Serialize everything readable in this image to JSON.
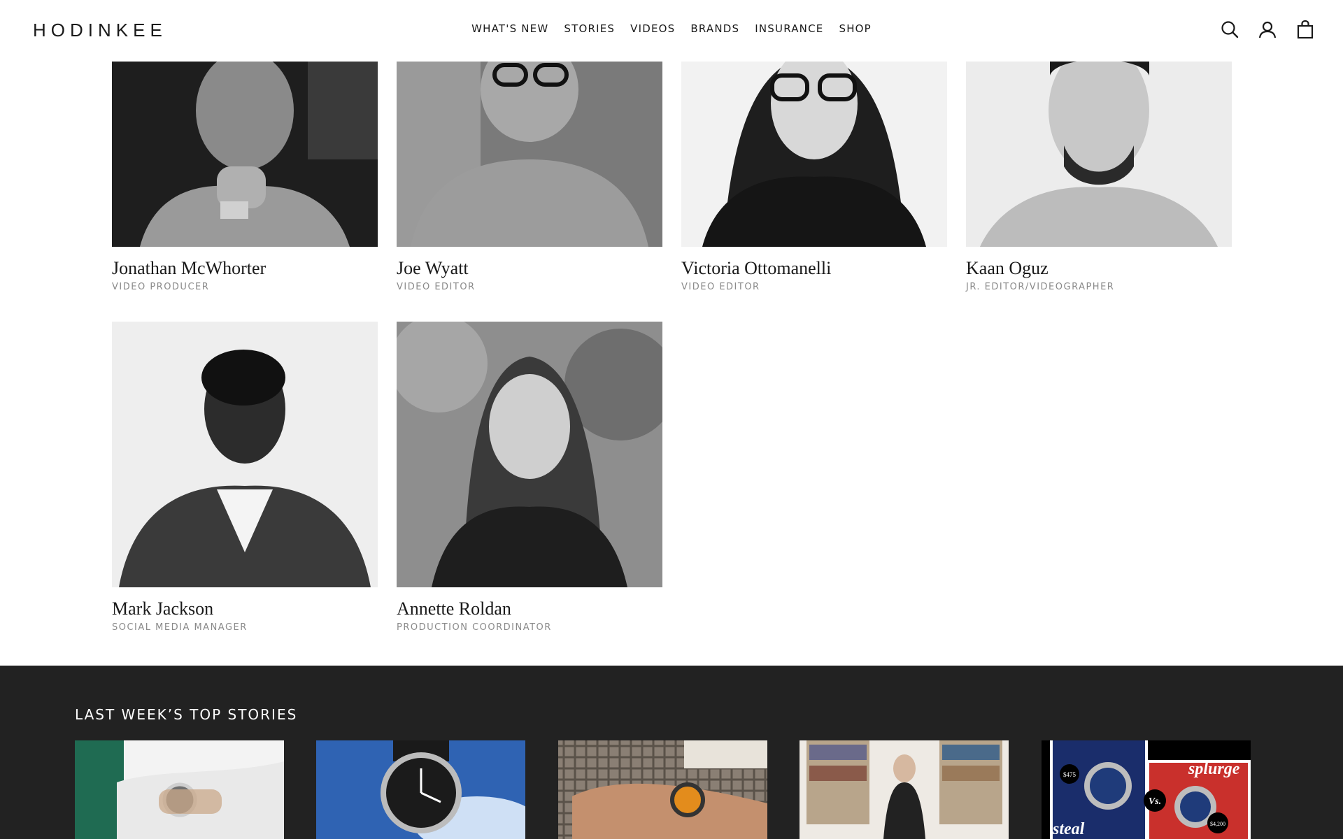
{
  "header": {
    "logo": "HODINKEE",
    "nav": [
      "WHAT'S NEW",
      "STORIES",
      "VIDEOS",
      "BRANDS",
      "INSURANCE",
      "SHOP"
    ]
  },
  "team": [
    {
      "name": "Jonathan McWhorter",
      "role": "VIDEO PRODUCER"
    },
    {
      "name": "Joe Wyatt",
      "role": "VIDEO EDITOR"
    },
    {
      "name": "Victoria Ottomanelli",
      "role": "VIDEO EDITOR"
    },
    {
      "name": "Kaan Oguz",
      "role": "JR. EDITOR/VIDEOGRAPHER"
    },
    {
      "name": "Mark Jackson",
      "role": "SOCIAL MEDIA MANAGER"
    },
    {
      "name": "Annette Roldan",
      "role": "PRODUCTION COORDINATOR"
    }
  ],
  "top_stories": {
    "title": "LAST WEEK’S TOP STORIES",
    "card5_text": {
      "steal": "steal",
      "splurge": "splurge",
      "vs": "Vs.",
      "price_low": "$475",
      "price_high": "$4,200"
    }
  },
  "colors": {
    "accent_dark": "#222222",
    "role_gray": "#8a8a8a"
  }
}
